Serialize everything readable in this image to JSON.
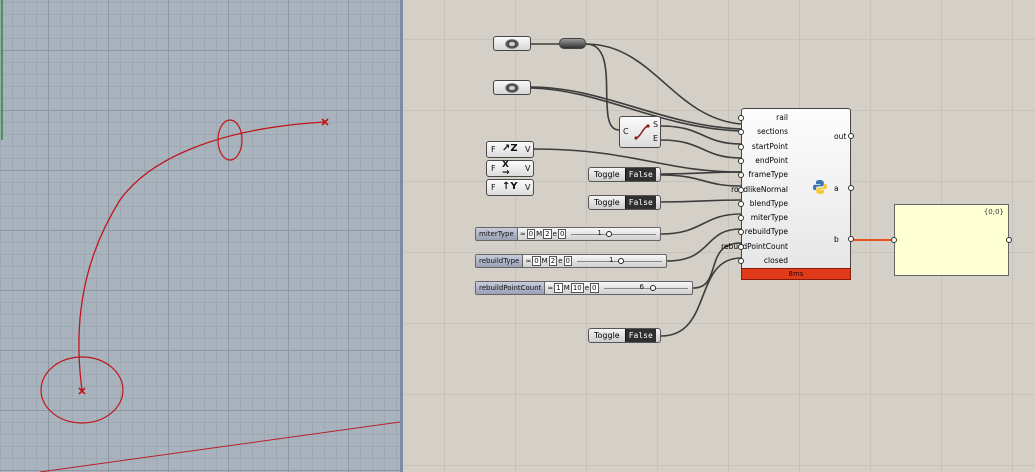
{
  "viewport": {
    "curve_color": "#c0161a",
    "grid_color": "#8d98a3",
    "axis_y_color": "#2e8b3a",
    "axis_x_color": "#b8202a"
  },
  "canvas": {
    "wire_color": "#3c3c3c",
    "selected_wire_color": "#e8541e"
  },
  "curve_param": {
    "input_c": "C",
    "out_s": "S",
    "out_e": "E"
  },
  "point_params": [
    {
      "f": "F",
      "axis": "Z",
      "v": "V"
    },
    {
      "f": "F",
      "axis": "X",
      "v": "V"
    },
    {
      "f": "F",
      "axis": "Y",
      "v": "V"
    }
  ],
  "toggles": [
    {
      "label": "Toggle",
      "value": "False"
    },
    {
      "label": "Toggle",
      "value": "False"
    },
    {
      "label": "Toggle",
      "value": "False"
    }
  ],
  "sliders": [
    {
      "name": "miterType",
      "d": "0",
      "m": "2",
      "e": "0",
      "value": "1"
    },
    {
      "name": "rebuildType",
      "d": "0",
      "m": "2",
      "e": "0",
      "value": "1"
    },
    {
      "name": "rebuildPointCount",
      "d": "1",
      "m": "10",
      "e": "0",
      "value": "6"
    }
  ],
  "python": {
    "inputs": [
      "rail",
      "sections",
      "startPoint",
      "endPoint",
      "frameType",
      "roadlikeNormal",
      "blendType",
      "miterType",
      "rebuildType",
      "rebuildPointCount",
      "closed"
    ],
    "outputs": [
      "out",
      "a",
      "b"
    ],
    "timing": "8ms"
  },
  "panel": {
    "path": "{0;0}"
  }
}
